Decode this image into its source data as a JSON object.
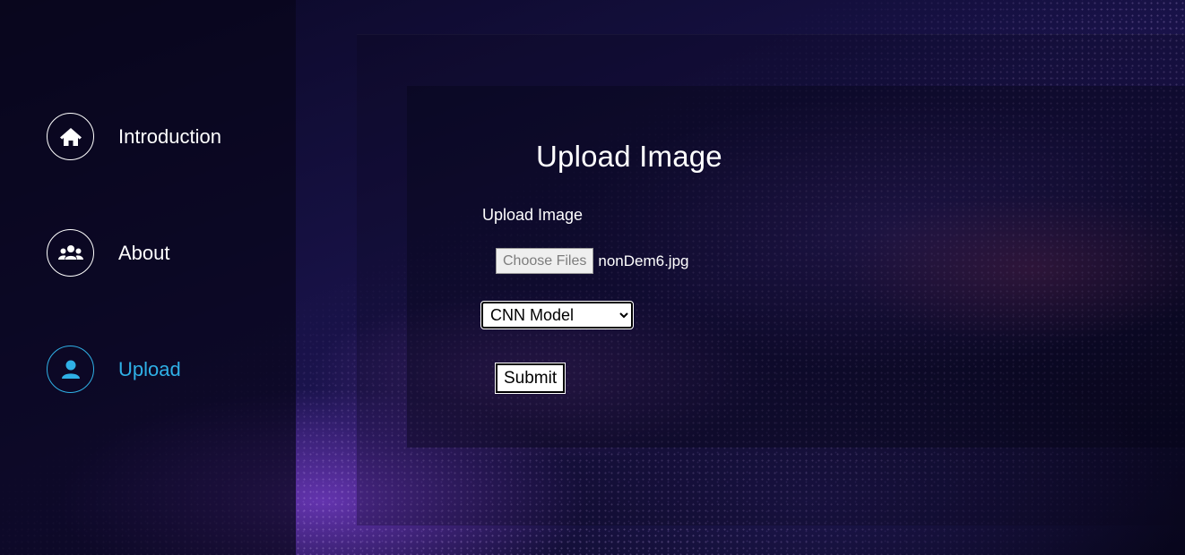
{
  "sidebar": {
    "items": [
      {
        "label": "Introduction",
        "icon": "home-icon",
        "active": false
      },
      {
        "label": "About",
        "icon": "users-icon",
        "active": false
      },
      {
        "label": "Upload",
        "icon": "user-icon",
        "active": true
      }
    ]
  },
  "main": {
    "title": "Upload Image",
    "upload_label": "Upload Image",
    "choose_files_label": "Choose Files",
    "selected_file": "nonDem6.jpg",
    "model_select": {
      "selected": "CNN Model",
      "options": [
        "CNN Model"
      ]
    },
    "submit_label": "Submit"
  },
  "colors": {
    "accent": "#2fb0e6",
    "text": "#ffffff",
    "background": "#0a0822"
  }
}
